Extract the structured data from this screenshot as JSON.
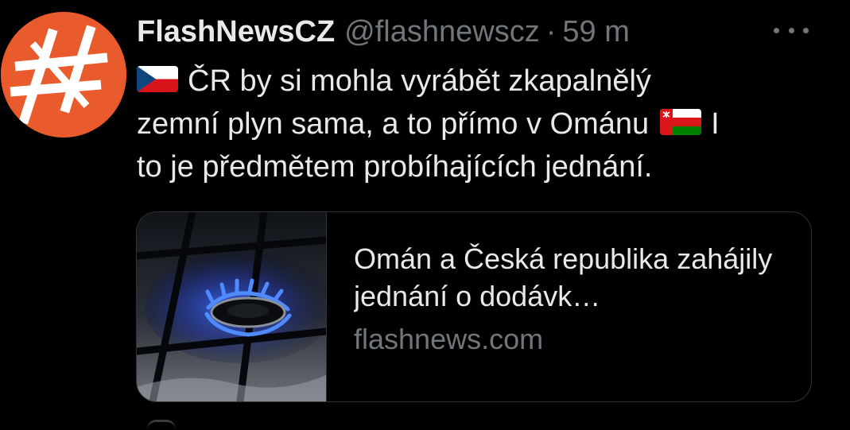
{
  "tweet": {
    "display_name": "FlashNewsCZ",
    "handle": "@flashnewscz",
    "separator": "·",
    "time": "59 m",
    "text_line1": "ČR by si mohla vyrábět zkapalnělý",
    "text_line2_a": "zemní plyn sama, a to přímo v Ománu",
    "text_line2_b": "I",
    "text_line3": "to je předmětem probíhajících jednání.",
    "flags": [
      "czech-flag-icon",
      "oman-flag-icon"
    ]
  },
  "card": {
    "title": "Omán a Česká republika zahájily jednání o dodávk…",
    "domain": "flashnews.com",
    "image": "gas-burner-flame-image"
  },
  "icons": {
    "avatar": "hashtag-logo-icon",
    "more": "more-options-icon"
  },
  "colors": {
    "background": "#000000",
    "text": "#e7e9ea",
    "secondary": "#71767b",
    "avatar": "#e95a2c",
    "border": "#2f3336"
  }
}
